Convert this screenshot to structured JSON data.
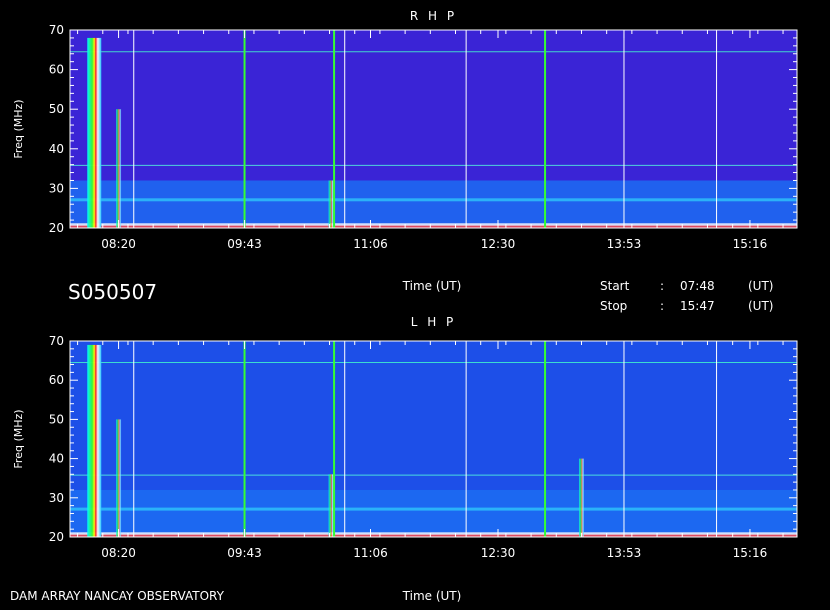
{
  "observation_id": "S050507",
  "footer_left": "DAM ARRAY   NANCAY OBSERVATORY",
  "start": {
    "label": "Start",
    "sep": ":",
    "time": "07:48",
    "unit": "(UT)"
  },
  "stop": {
    "label": "Stop",
    "sep": ":",
    "time": "15:47",
    "unit": "(UT)"
  },
  "colors": {
    "background": "#000000",
    "axis": "#ffffff",
    "bg_rhp": "#3a24d6",
    "bg_lhp": "#1d4fe8"
  },
  "chart_data": [
    {
      "type": "heatmap",
      "title": "R H P",
      "xlabel": "Time (UT)",
      "ylabel": "Freq (MHz)",
      "xlim": [
        "07:48",
        "15:47"
      ],
      "ylim": [
        20,
        70
      ],
      "x_ticks": [
        "08:20",
        "09:43",
        "11:06",
        "12:30",
        "13:53",
        "15:16"
      ],
      "y_ticks": [
        20,
        30,
        40,
        50,
        60,
        70
      ],
      "vertical_lines": [
        {
          "time": "08:30",
          "color": "#ffffff"
        },
        {
          "time": "09:43",
          "color": "#33ff33"
        },
        {
          "time": "10:42",
          "color": "#33ff33"
        },
        {
          "time": "10:49",
          "color": "#ffffff"
        },
        {
          "time": "12:09",
          "color": "#ffffff"
        },
        {
          "time": "13:01",
          "color": "#33ff33"
        },
        {
          "time": "13:53",
          "color": "#ffffff"
        },
        {
          "time": "14:54",
          "color": "#ffffff"
        }
      ],
      "horizontal_lines": [
        {
          "freq": 64.5,
          "color": "#44ffcc"
        },
        {
          "freq": 35.8,
          "color": "#55ffdd"
        }
      ],
      "bursts": [
        {
          "time": "08:04",
          "f_low": 20,
          "f_high": 68
        },
        {
          "time": "08:20",
          "f_low": 20,
          "f_high": 50
        },
        {
          "time": "10:40",
          "f_low": 20,
          "f_high": 32
        }
      ]
    },
    {
      "type": "heatmap",
      "title": "L H P",
      "xlabel": "Time (UT)",
      "ylabel": "Freq (MHz)",
      "xlim": [
        "07:48",
        "15:47"
      ],
      "ylim": [
        20,
        70
      ],
      "x_ticks": [
        "08:20",
        "09:43",
        "11:06",
        "12:30",
        "13:53",
        "15:16"
      ],
      "y_ticks": [
        20,
        30,
        40,
        50,
        60,
        70
      ],
      "vertical_lines": [
        {
          "time": "08:30",
          "color": "#ffffff"
        },
        {
          "time": "09:43",
          "color": "#33ff33"
        },
        {
          "time": "10:42",
          "color": "#33ff33"
        },
        {
          "time": "10:49",
          "color": "#ffffff"
        },
        {
          "time": "12:09",
          "color": "#ffffff"
        },
        {
          "time": "13:01",
          "color": "#33ff33"
        },
        {
          "time": "13:53",
          "color": "#ffffff"
        },
        {
          "time": "14:54",
          "color": "#ffffff"
        }
      ],
      "horizontal_lines": [
        {
          "freq": 64.5,
          "color": "#44ffcc"
        },
        {
          "freq": 35.8,
          "color": "#55ffdd"
        }
      ],
      "bursts": [
        {
          "time": "08:04",
          "f_low": 20,
          "f_high": 69
        },
        {
          "time": "08:20",
          "f_low": 20,
          "f_high": 50
        },
        {
          "time": "10:40",
          "f_low": 20,
          "f_high": 36
        },
        {
          "time": "13:25",
          "f_low": 20,
          "f_high": 40
        }
      ]
    }
  ]
}
